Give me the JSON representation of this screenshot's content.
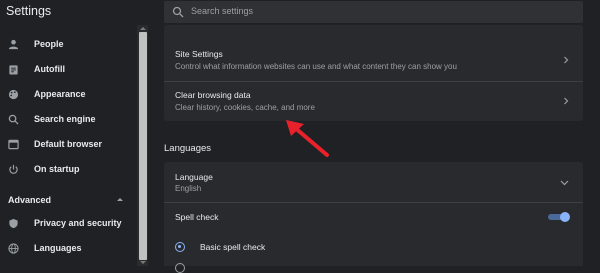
{
  "header": {
    "app_title": "Settings",
    "search_placeholder": "Search settings"
  },
  "sidebar": {
    "items": [
      {
        "label": "People",
        "icon": "person-icon"
      },
      {
        "label": "Autofill",
        "icon": "clipboard-icon"
      },
      {
        "label": "Appearance",
        "icon": "palette-icon"
      },
      {
        "label": "Search engine",
        "icon": "search-icon"
      },
      {
        "label": "Default browser",
        "icon": "browser-window-icon"
      },
      {
        "label": "On startup",
        "icon": "power-icon"
      }
    ],
    "advanced_label": "Advanced",
    "advanced_items": [
      {
        "label": "Privacy and security",
        "icon": "shield-icon"
      },
      {
        "label": "Languages",
        "icon": "globe-icon"
      }
    ]
  },
  "privacy_card": {
    "rows": [
      {
        "title": "Site Settings",
        "description": "Control what information websites can use and what content they can show you"
      },
      {
        "title": "Clear browsing data",
        "description": "Clear history, cookies, cache, and more"
      }
    ]
  },
  "languages_section": {
    "heading": "Languages",
    "language_row": {
      "title": "Language",
      "value": "English"
    },
    "spell_check_label": "Spell check",
    "spell_check_enabled": true,
    "basic_spell_check_label": "Basic spell check"
  },
  "annotation": {
    "arrow_color": "#e8212b",
    "target": "Clear browsing data"
  },
  "colors": {
    "background": "#202124",
    "card": "#292a2d",
    "accent": "#8ab4f8",
    "text_primary": "#e8eaed",
    "text_secondary": "#9aa0a6"
  }
}
